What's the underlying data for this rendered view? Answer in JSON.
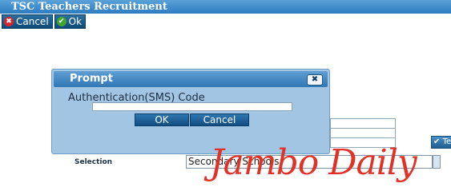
{
  "window": {
    "title": "TSC Teachers Recruitment"
  },
  "toolbar": {
    "cancel_label": "Cancel",
    "ok_label": "Ok"
  },
  "background": {
    "selection_label": "Selection",
    "selection_value": "Secondary Schools",
    "button_partial_label": "Te"
  },
  "dialog": {
    "title": "Prompt",
    "field_label": "Authentication(SMS) Code",
    "field_value": "",
    "ok_label": "OK",
    "cancel_label": "Cancel"
  },
  "watermark": {
    "text": "Jambo Daily"
  },
  "colors": {
    "title_bar": "#2d7cc0",
    "dialog_bg": "#a3c5e4",
    "watermark": "#e23227",
    "cancel_icon": "#d9262b",
    "ok_icon": "#43a532"
  }
}
